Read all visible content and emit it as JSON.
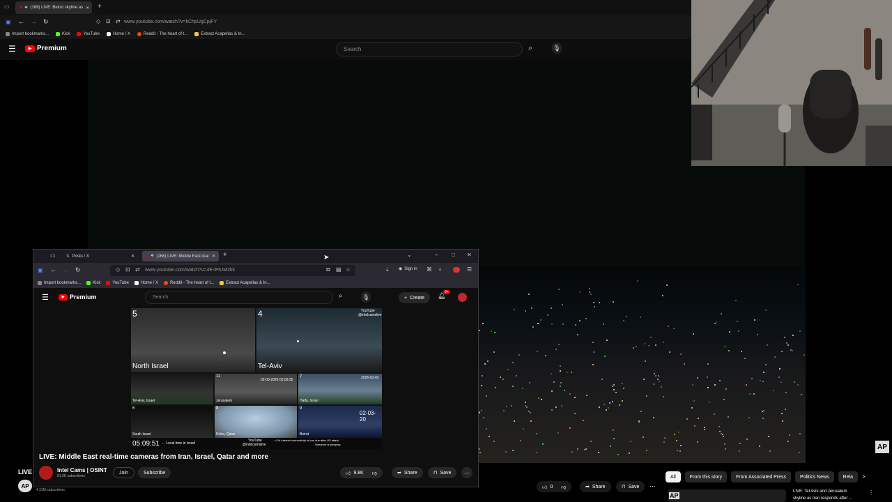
{
  "back_browser": {
    "tab_title": "(168) LIVE: Beirut skyline as",
    "url": "www.youtube.com/watch?v=kChpUgCpjFY",
    "bookmarks": [
      "Import bookmarks...",
      "Kick",
      "YouTube",
      "Home / X",
      "Reddit - The heart of t...",
      "Extract Acapellas & In..."
    ]
  },
  "back_youtube": {
    "logo_text": "Premium",
    "search_placeholder": "Search",
    "live_label": "LIVE",
    "subscribers": "4.31M subscribers",
    "ap_badge": "AP",
    "like_count": "0",
    "share_label": "Share",
    "save_label": "Save",
    "chips": [
      "All",
      "From this story",
      "From Associated Press",
      "Politics News",
      "Rela"
    ],
    "related_title_1": "LIVE: Tel Aviv and Jerusalem",
    "related_title_2": "skyline as Iran responds after ..."
  },
  "front_browser": {
    "tabs": [
      {
        "title": "Posts / X"
      },
      {
        "title": "(168) LIVE: Middle East real"
      }
    ],
    "url": "www.youtube.com/watch?v=4E-iFtUM2kk",
    "sign_in_label": "Sign in",
    "bookmarks": [
      "Import bookmarks...",
      "Kick",
      "YouTube",
      "Home / X",
      "Reddit - The heart of t...",
      "Extract Acapellas & In..."
    ]
  },
  "front_youtube": {
    "logo_text": "Premium",
    "search_placeholder": "Search",
    "create_label": "Create",
    "notification_count": "9+",
    "video_title": "LIVE: Middle East real-time cameras from Iran, Israel, Qatar and more",
    "channel_name": "Intel Cams | OSINT",
    "channel_subscribers": "81.9K subscribers",
    "join_label": "Join",
    "subscribe_label": "Subscribe",
    "like_count": "9.8K",
    "share_label": "Share",
    "save_label": "Save"
  },
  "camera_grid": {
    "cam5_num": "5",
    "cam5_label": "North Israel",
    "cam4_num": "4",
    "cam4_label": "Tel-Aviv",
    "cam4_watermark_1": "YouTube",
    "cam4_watermark_2": "@intelcamslive",
    "cam_a_label": "Tel-Aviv, Israel",
    "cam11_num": "11",
    "cam_b_timestamp": "02-03-2026 05:09:35",
    "cam_b_label": "Jerusalem",
    "cam7_num": "7",
    "cam7_timestamp": "2026-03-02",
    "cam7_label": "Haifa, Israel",
    "cam6_num": "6",
    "cam6_label": "South Israel",
    "cam8_num": "8",
    "cam8_label": "Doha, Qatar",
    "cam9_num": "9",
    "cam9_timestamp": "02-03-20",
    "cam9_label": "Beirut",
    "clock": "05:09:51",
    "clock_note": "← Local time in Israel",
    "footer_youtube": "YouTube",
    "footer_handle": "@intelcamslive",
    "footer_note_1": "<1% Internet connectivity in Iran due after US attack",
    "footer_note_2": "Streamer is sleeping"
  },
  "colors": {
    "youtube_red": "#ff0000",
    "background": "#0f0f0f",
    "chip_active": "#f1f1f1"
  }
}
